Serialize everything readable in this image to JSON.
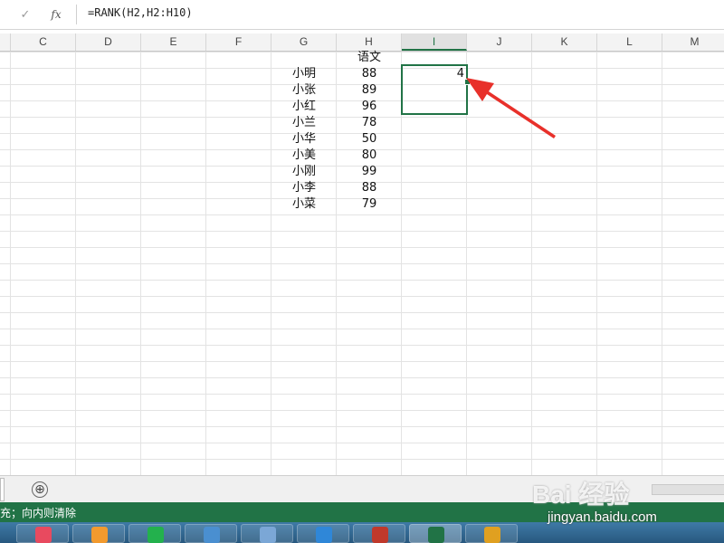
{
  "formula_bar": {
    "cancel_icon": "x-icon",
    "enter_icon": "check-icon",
    "enter_symbol": "✓",
    "fx_label": "fx",
    "formula": "=RANK(H2,H2:H10)"
  },
  "columns": [
    "C",
    "D",
    "E",
    "F",
    "G",
    "H",
    "I",
    "J",
    "K",
    "L",
    "M"
  ],
  "active_column": "I",
  "cells": {
    "header": "语文",
    "names": [
      "小明",
      "小张",
      "小红",
      "小兰",
      "小华",
      "小美",
      "小刚",
      "小李",
      "小菜"
    ],
    "scores": [
      "88",
      "89",
      "96",
      "78",
      "50",
      "80",
      "99",
      "88",
      "79"
    ],
    "rank_value": "4"
  },
  "sheet_tabs": {
    "add_symbol": "⊕"
  },
  "status_bar": {
    "text": "充；向内则清除",
    "color": "#217346"
  },
  "watermark": {
    "logo": "Bai 经验",
    "url": "jingyan.baidu.com"
  },
  "taskbar": {
    "items": [
      {
        "icon": "pinwheel-app-icon",
        "color": "#e84a5f"
      },
      {
        "icon": "flame-app-icon",
        "color": "#f29a2e"
      },
      {
        "icon": "iqiyi-icon",
        "color": "#23b14d"
      },
      {
        "icon": "film-icon",
        "color": "#4a8fd0"
      },
      {
        "icon": "monitor-icon",
        "color": "#7ba7d6"
      },
      {
        "icon": "internet-explorer-icon",
        "color": "#2f87d8"
      },
      {
        "icon": "game-icon",
        "color": "#c0392b"
      },
      {
        "icon": "excel-icon",
        "color": "#217346"
      },
      {
        "icon": "bird-app-icon",
        "color": "#e0a020"
      }
    ]
  },
  "annotation": {
    "arrow_color": "#e8302a"
  }
}
